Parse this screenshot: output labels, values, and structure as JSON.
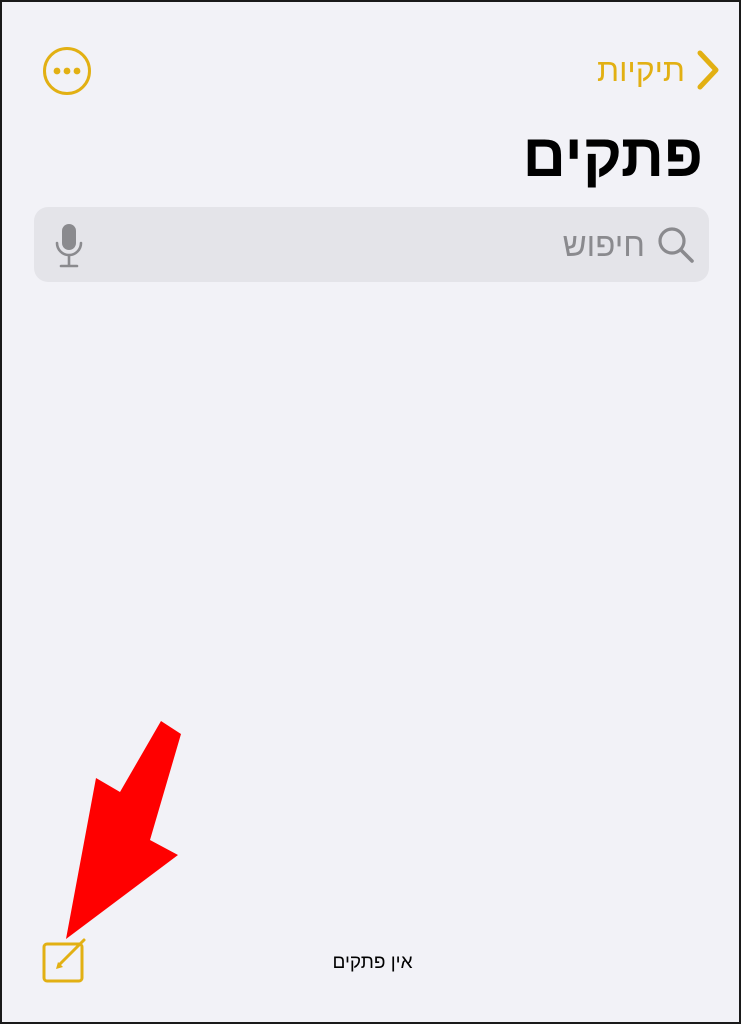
{
  "header": {
    "back_label": "תיקיות",
    "title": "פתקים"
  },
  "search": {
    "placeholder": "חיפוש",
    "value": ""
  },
  "toolbar": {
    "notes_count_label": "אין פתקים"
  },
  "icons": {
    "back": "chevron-right-icon",
    "more": "ellipsis-circle-icon",
    "search": "magnifying-glass-icon",
    "mic": "microphone-icon",
    "compose": "compose-note-icon",
    "annotation": "red-arrow"
  },
  "colors": {
    "accent": "#e2b013",
    "background": "#f2f2f7",
    "search_field": "#e4e4e9",
    "secondary_text": "#8a8a8e",
    "annotation_arrow": "#ff0000"
  }
}
